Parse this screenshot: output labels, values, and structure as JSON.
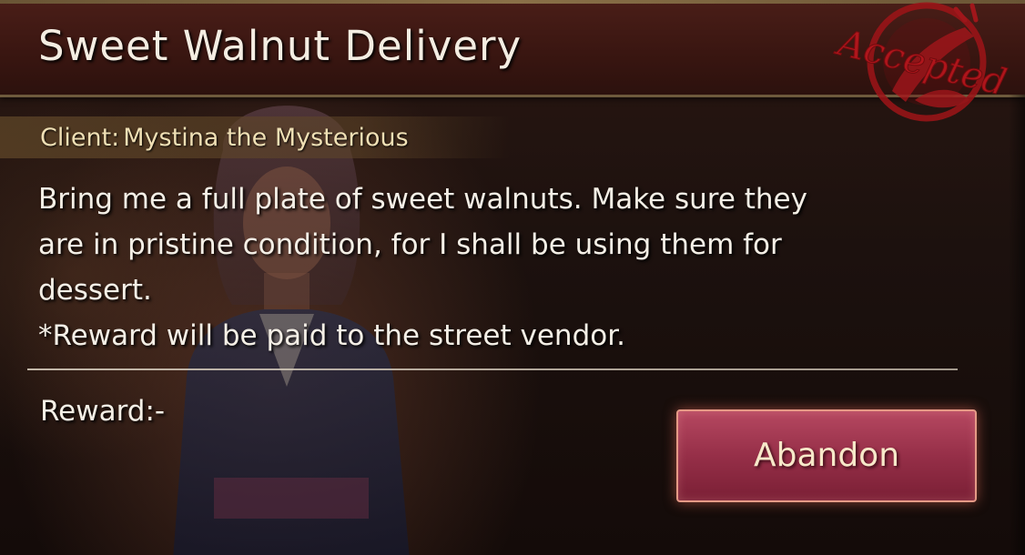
{
  "quest": {
    "title": "Sweet Walnut Delivery",
    "status_stamp": "Accepted",
    "client_label": "Client:",
    "client_name": "Mystina the Mysterious",
    "description_lines": [
      "Bring me a full plate of sweet walnuts. Make sure they",
      "are in pristine condition, for I shall be using them for",
      "dessert.",
      "*Reward will be paid to the street vendor."
    ],
    "reward_label": "Reward:",
    "reward_value": "-"
  },
  "actions": {
    "abandon_label": "Abandon"
  },
  "colors": {
    "title_bar": "#3a1611",
    "stamp": "#b0161c",
    "button": "#962f48",
    "button_border": "#e59a86",
    "client_text": "#efdfb4"
  }
}
